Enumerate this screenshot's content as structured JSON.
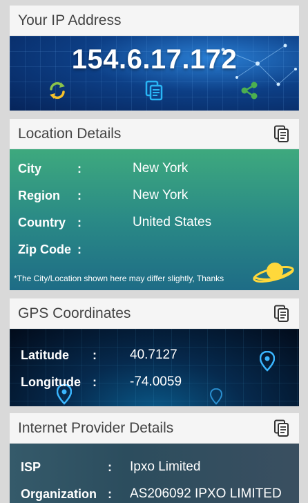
{
  "ip_card": {
    "title": "Your IP Address",
    "ip_address": "154.6.17.172",
    "actions": [
      {
        "icon": "refresh-icon",
        "color": "#8bc34a"
      },
      {
        "icon": "copy-icon",
        "color": "#2196f3"
      },
      {
        "icon": "share-icon",
        "color": "#4caf50"
      }
    ]
  },
  "location_card": {
    "title": "Location Details",
    "header_icon": "copy-icon",
    "rows": [
      {
        "label": "City",
        "separator": ":",
        "value": "New York"
      },
      {
        "label": "Region",
        "separator": ":",
        "value": "New York"
      },
      {
        "label": "Country",
        "separator": ":",
        "value": "United States"
      },
      {
        "label": "Zip Code",
        "separator": ":",
        "value": ""
      }
    ],
    "note": "*The City/Location shown here may differ slightly, Thanks"
  },
  "gps_card": {
    "title": "GPS Coordinates",
    "header_icon": "copy-icon",
    "rows": [
      {
        "label": "Latitude",
        "separator": ":",
        "value": "40.7127"
      },
      {
        "label": "Longitude",
        "separator": ":",
        "value": "-74.0059"
      }
    ]
  },
  "isp_card": {
    "title": "Internet Provider Details",
    "header_icon": "copy-icon",
    "rows": [
      {
        "label": "ISP",
        "separator": ":",
        "value": "Ipxo Limited"
      },
      {
        "label": "Organization",
        "separator": ":",
        "value": "AS206092 IPXO LIMITED"
      }
    ]
  },
  "colors": {
    "background": "#d9d9d9",
    "header_bg": "#f5f5f5",
    "ip_banner": "#0d3f86",
    "location_gradient_top": "#3ea97e",
    "location_gradient_bottom": "#1e6c86",
    "gps_bg": "#062a4e",
    "isp_bg": "#2c4d5e",
    "planet": "#ffd83b"
  }
}
